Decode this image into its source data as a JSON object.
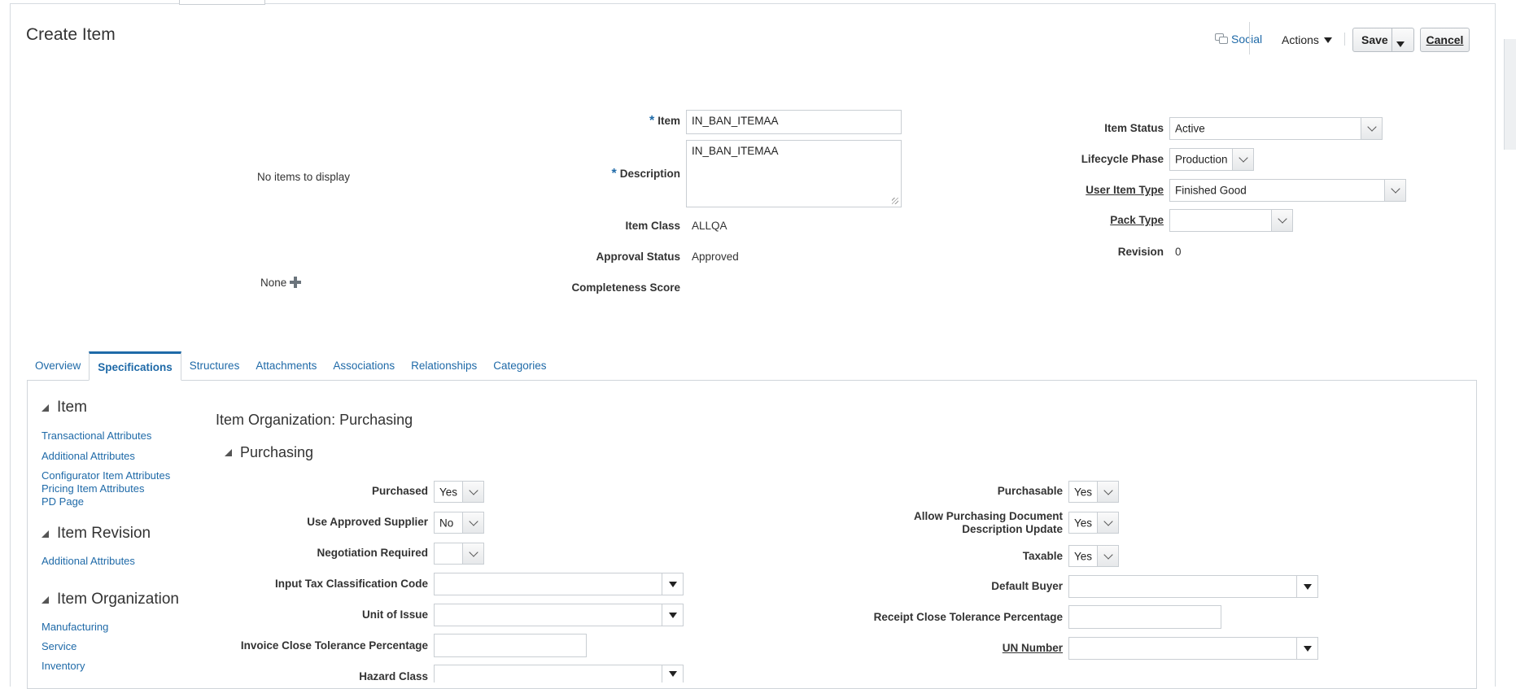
{
  "header": {
    "title": "Create Item",
    "social": "Social",
    "actions": "Actions",
    "save": "Save",
    "cancel": "Cancel"
  },
  "left_summary": {
    "empty": "No items to display",
    "none": "None"
  },
  "item_fields": {
    "item_label": "Item",
    "item_value": "IN_BAN_ITEMAA",
    "description_label": "Description",
    "description_value": "IN_BAN_ITEMAA",
    "item_class_label": "Item Class",
    "item_class_value": "ALLQA",
    "approval_status_label": "Approval Status",
    "approval_status_value": "Approved",
    "completeness_label": "Completeness Score"
  },
  "status_fields": {
    "item_status_label": "Item Status",
    "item_status_value": "Active",
    "lifecycle_label": "Lifecycle Phase",
    "lifecycle_value": "Production",
    "user_item_type_label": "User Item Type",
    "user_item_type_value": "Finished Good",
    "pack_type_label": "Pack Type",
    "pack_type_value": "",
    "revision_label": "Revision",
    "revision_value": "0"
  },
  "tabs": [
    {
      "label": "Overview"
    },
    {
      "label": "Specifications",
      "active": true
    },
    {
      "label": "Structures"
    },
    {
      "label": "Attachments"
    },
    {
      "label": "Associations"
    },
    {
      "label": "Relationships"
    },
    {
      "label": "Categories"
    }
  ],
  "sidebar": {
    "item_heading": "Item",
    "item_links": [
      "Transactional Attributes",
      "Additional Attributes",
      "Configurator Item Attributes",
      "Pricing Item Attributes",
      "PD Page"
    ],
    "revision_heading": "Item Revision",
    "revision_links": [
      "Additional Attributes"
    ],
    "org_heading": "Item Organization",
    "org_links": [
      "Manufacturing",
      "Service",
      "Inventory"
    ]
  },
  "content": {
    "section_title": "Item Organization: Purchasing",
    "subsection_title": "Purchasing",
    "left_fields": {
      "purchased_label": "Purchased",
      "purchased_value": "Yes",
      "approved_supplier_label": "Use Approved Supplier",
      "approved_supplier_value": "No",
      "negotiation_label": "Negotiation Required",
      "negotiation_value": "",
      "input_tax_label": "Input Tax Classification Code",
      "input_tax_value": "",
      "unit_of_issue_label": "Unit of Issue",
      "unit_of_issue_value": "",
      "invoice_close_label": "Invoice Close Tolerance Percentage",
      "invoice_close_value": "",
      "hazard_class_label": "Hazard Class",
      "hazard_class_value": ""
    },
    "right_fields": {
      "purchasable_label": "Purchasable",
      "purchasable_value": "Yes",
      "allow_desc_label_1": "Allow Purchasing Document",
      "allow_desc_label_2": "Description Update",
      "allow_desc_value": "Yes",
      "taxable_label": "Taxable",
      "taxable_value": "Yes",
      "default_buyer_label": "Default Buyer",
      "default_buyer_value": "",
      "receipt_close_label": "Receipt Close Tolerance Percentage",
      "receipt_close_value": "",
      "un_number_label": "UN Number",
      "un_number_value": ""
    }
  }
}
